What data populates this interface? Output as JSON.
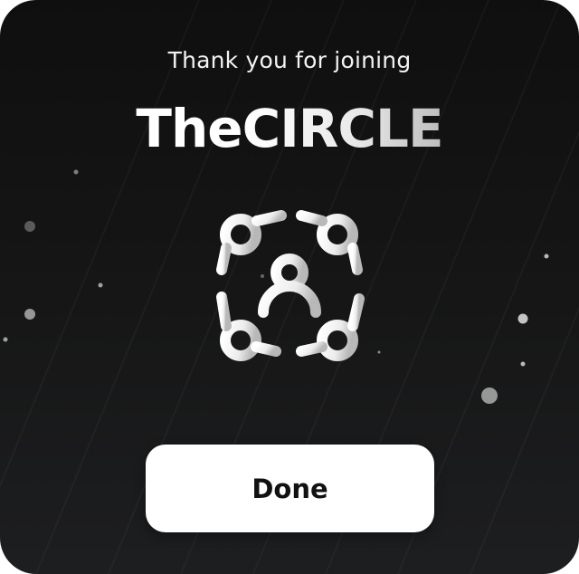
{
  "dialog": {
    "subtitle": "Thank you for joining",
    "brand_part1": "The",
    "brand_part2": "CIRCLE",
    "logo_icon": "community-circle-icon",
    "done_label": "Done"
  },
  "colors": {
    "background_top": "#0f0f0f",
    "background_bottom": "#1d1e20",
    "text": "#ffffff",
    "button_bg": "#ffffff",
    "button_text": "#111111"
  }
}
